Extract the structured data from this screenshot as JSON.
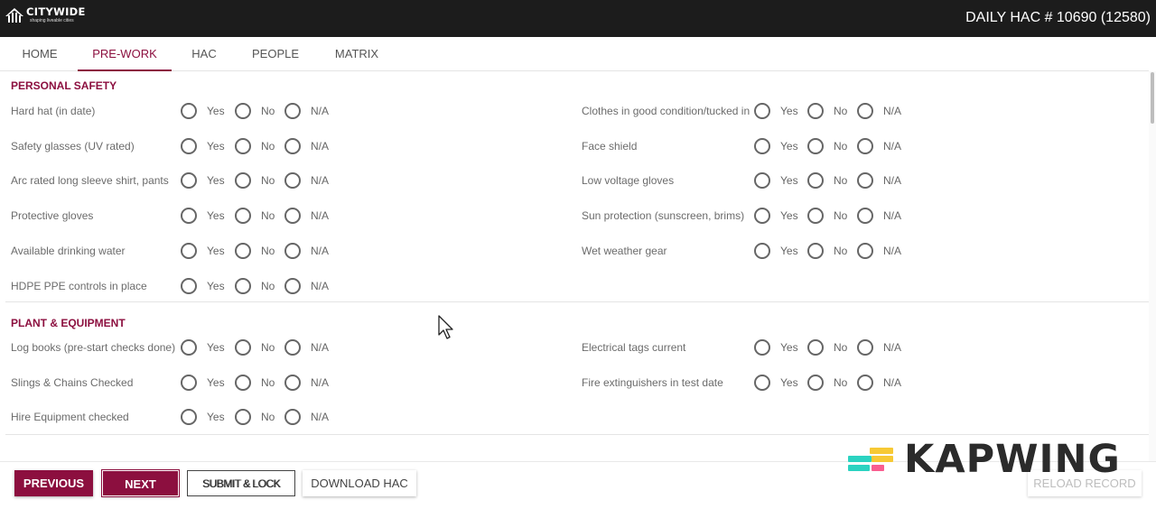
{
  "header": {
    "logo_name": "CITYWIDE",
    "logo_tagline": "shaping liveable cities",
    "title": "DAILY HAC # 10690 (12580)"
  },
  "tabs": [
    {
      "label": "HOME",
      "active": false
    },
    {
      "label": "PRE-WORK",
      "active": true
    },
    {
      "label": "HAC",
      "active": false
    },
    {
      "label": "PEOPLE",
      "active": false
    },
    {
      "label": "MATRIX",
      "active": false
    }
  ],
  "options": [
    "Yes",
    "No",
    "N/A"
  ],
  "sections": {
    "personal_safety": {
      "title": "PERSONAL SAFETY",
      "left": [
        "Hard hat (in date)",
        "Safety glasses (UV rated)",
        "Arc rated long sleeve shirt, pants",
        "Protective gloves",
        "Available drinking water",
        "HDPE PPE controls in place"
      ],
      "right": [
        "Clothes in good condition/tucked in",
        "Face shield",
        "Low voltage gloves",
        "Sun protection (sunscreen, brims)",
        "Wet weather gear"
      ]
    },
    "plant_equipment": {
      "title": "PLANT & EQUIPMENT",
      "left": [
        "Log books (pre-start checks done)",
        "Slings & Chains Checked",
        "Hire Equipment checked"
      ],
      "right": [
        "Electrical tags current",
        "Fire extinguishers in test date"
      ]
    }
  },
  "footer": {
    "previous": "PREVIOUS",
    "next": "NEXT",
    "submit_lock": "SUBMIT & LOCK",
    "download": "DOWNLOAD HAC",
    "reload": "RELOAD RECORD"
  },
  "watermark": {
    "text": "KAPWING",
    "colors": [
      "#f7c934",
      "#2bd3c1",
      "#f95d8f"
    ]
  },
  "colors": {
    "accent": "#8c0f3f",
    "topbar": "#1c1c1c"
  }
}
